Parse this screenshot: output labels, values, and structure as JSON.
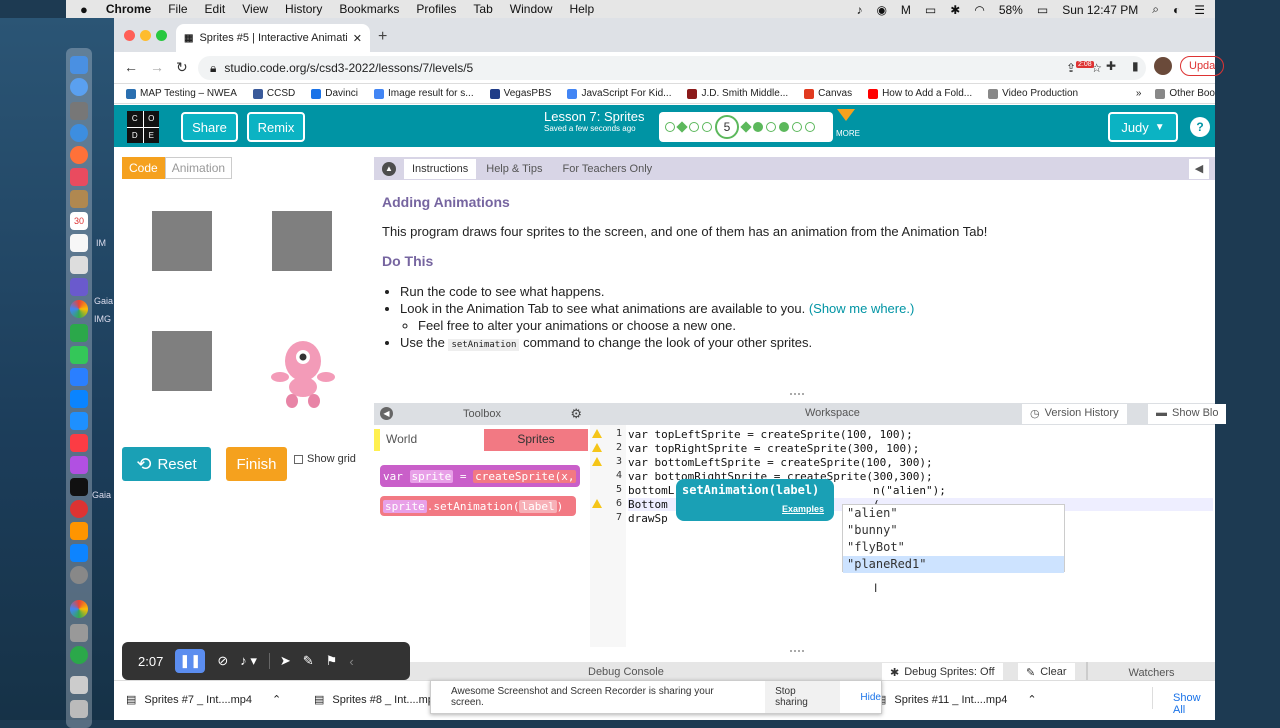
{
  "desktop": {
    "label_1": "IM",
    "label_2": "IMG",
    "label_3": "Gaia",
    "label_4": "Gaia"
  },
  "menubar": {
    "app": "Chrome",
    "items": [
      "File",
      "Edit",
      "View",
      "History",
      "Bookmarks",
      "Profiles",
      "Tab",
      "Window",
      "Help"
    ],
    "battery": "58%",
    "clock": "Sun 12:47 PM"
  },
  "browser": {
    "tab_title": "Sprites #5 | Interactive Animati",
    "new_tab": "+",
    "url": "studio.code.org/s/csd3-2022/lessons/7/levels/5",
    "update_label": "Upda",
    "ext_badge": "2:08"
  },
  "bookmarks": [
    {
      "label": "MAP Testing – NWEA",
      "color": "#2a6fb0"
    },
    {
      "label": "CCSD",
      "color": "#3a5a9a"
    },
    {
      "label": "Davinci",
      "color": "#1a73e8"
    },
    {
      "label": "Image result for s...",
      "color": "#4285f4"
    },
    {
      "label": "VegasPBS",
      "color": "#1f3c88"
    },
    {
      "label": "JavaScript For Kid...",
      "color": "#4285f4"
    },
    {
      "label": "J.D. Smith Middle...",
      "color": "#8b1a1a"
    },
    {
      "label": "Canvas",
      "color": "#e13a1f"
    },
    {
      "label": "How to Add a Fold...",
      "color": "#ff0000"
    },
    {
      "label": "Video Production",
      "color": "#888888"
    }
  ],
  "bookmarks_more": "»",
  "other_bookmarks": "Other Boo",
  "header": {
    "logo": [
      "C",
      "O",
      "D",
      "E"
    ],
    "share": "Share",
    "remix": "Remix",
    "lesson_title": "Lesson 7: Sprites",
    "saved": "Saved a few seconds ago",
    "current_level": "5",
    "more": "MORE",
    "user": "Judy",
    "help": "?"
  },
  "stage": {
    "tab_code": "Code",
    "tab_animation": "Animation",
    "reset": "Reset",
    "finish": "Finish",
    "show_grid": "Show grid"
  },
  "instructions": {
    "tabs": [
      "Instructions",
      "Help & Tips",
      "For Teachers Only"
    ],
    "heading1": "Adding Animations",
    "intro": "This program draws four sprites to the screen, and one of them has an animation from the Animation Tab!",
    "heading2": "Do This",
    "b1": "Run the code to see what happens.",
    "b2": "Look in the Animation Tab to see what animations are available to you.",
    "b2_link": "(Show me where.)",
    "b2_sub": "Feel free to alter your animations or choose a new one.",
    "b3_pre": "Use the",
    "b3_code": "setAnimation",
    "b3_post": "command to change the look of your other sprites."
  },
  "toolbox": {
    "title": "Toolbox",
    "cat_world": "World",
    "cat_sprites": "Sprites",
    "block1_var": "var",
    "block1_name": "sprite",
    "block1_eq": "=",
    "block1_call": "createSprite(x,",
    "block2_obj": "sprite",
    "block2_call": ".setAnimation(",
    "block2_arg": "label",
    "block2_close": ")"
  },
  "workspace": {
    "title": "Workspace",
    "version_history": "Version History",
    "show_blocks": "Show Blo",
    "lines": [
      {
        "n": "1",
        "text": "var topLeftSprite = createSprite(100, 100);"
      },
      {
        "n": "2",
        "text": "var topRightSprite = createSprite(300, 100);"
      },
      {
        "n": "3",
        "text": "var bottomLeftSprite = createSprite(100, 300);"
      },
      {
        "n": "4",
        "text": "var bottomRightSprite = createSprite(300,300);"
      },
      {
        "n": "5",
        "text": "bottomL                              n(\"alien\");"
      },
      {
        "n": "6",
        "text": "Bottom                               ("
      },
      {
        "n": "7",
        "text": "drawSp"
      }
    ],
    "tooltip_sig": "setAnimation(label)",
    "tooltip_examples": "Examples",
    "autocomplete": [
      "\"alien\"",
      "\"bunny\"",
      "\"flyBot\"",
      "\"planeRed1\""
    ]
  },
  "debug": {
    "console": "Debug Console",
    "debug_sprites": "Debug Sprites: Off",
    "clear": "Clear",
    "watchers": "Watchers"
  },
  "recorder": {
    "time": "2:07"
  },
  "downloads": [
    {
      "label": "Sprites #7 _ Int....mp4"
    },
    {
      "label": "Sprites #8 _ Int....mp4"
    },
    {
      "label": "Sprites #11 _ Int....mp4"
    }
  ],
  "show_all": "Show All",
  "sharebar": {
    "msg": "Awesome Screenshot and Screen Recorder is sharing your screen.",
    "stop": "Stop sharing",
    "hide": "Hide"
  }
}
